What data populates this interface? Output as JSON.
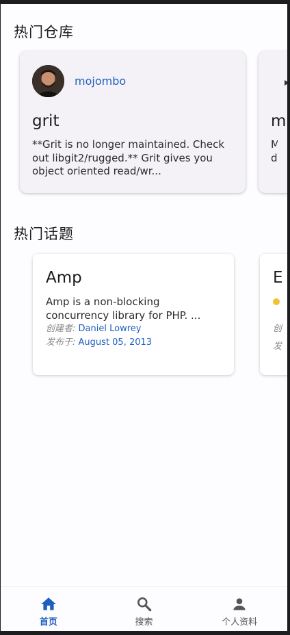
{
  "sections": {
    "repos_title": "热门仓库",
    "topics_title": "热门话题"
  },
  "repos": [
    {
      "owner": "mojombo",
      "name": "grit",
      "description": "**Grit is no longer maintained. Check out libgit2/rugged.** Grit gives you object oriented read/wr..."
    },
    {
      "owner": "",
      "name": "m",
      "description": "M d"
    }
  ],
  "topics": [
    {
      "name": "Amp",
      "description": "Amp is a non-blocking concurrency library for PHP. ...",
      "creator_label": "创建者:",
      "creator": "Daniel Lowrey",
      "published_label": "发布于:",
      "published": "August 05, 2013"
    },
    {
      "name": "E",
      "description": "",
      "creator_label": "创",
      "creator": "",
      "published_label": "发",
      "published": ""
    }
  ],
  "nav": {
    "items": [
      {
        "label": "首页",
        "icon": "home-icon",
        "active": true
      },
      {
        "label": "搜索",
        "icon": "search-icon",
        "active": false
      },
      {
        "label": "个人资料",
        "icon": "person-icon",
        "active": false
      }
    ]
  },
  "colors": {
    "accent": "#1f5fbf",
    "repo_card_bg": "#f4f2f7",
    "page_bg": "#fdfcff"
  }
}
